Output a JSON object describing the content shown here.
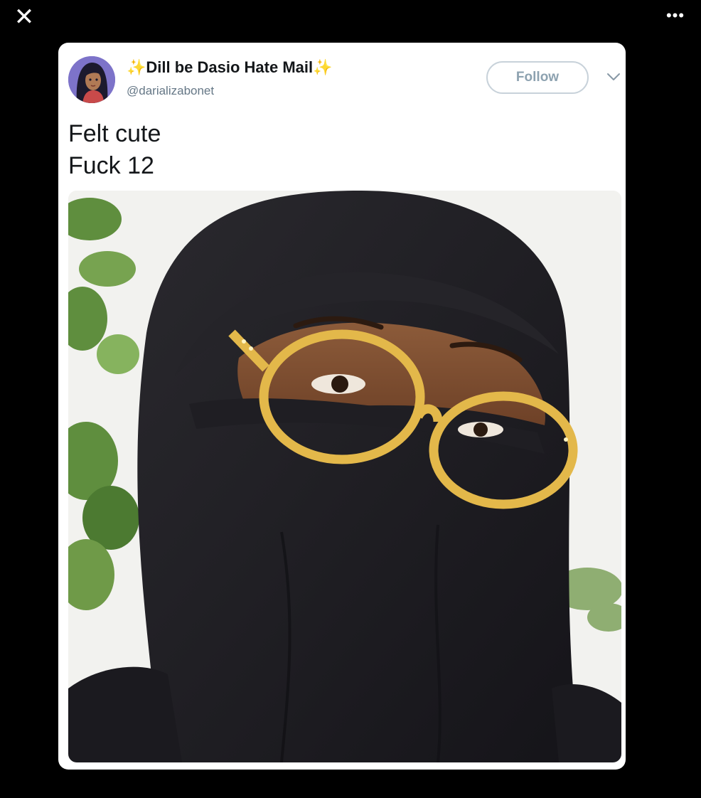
{
  "viewer": {
    "close_icon": "close-icon",
    "more_icon": "more-horizontal-icon",
    "close_glyph": "✕",
    "more_glyph": "•••"
  },
  "tweet": {
    "display_name": "✨Dill be Dasio Hate Mail✨",
    "handle": "@darializabonet",
    "follow_label": "Follow",
    "text_lines": [
      "Felt cute",
      "Fuck 12"
    ],
    "avatar_icon": "avatar",
    "chevron_icon": "chevron-down-icon"
  },
  "colors": {
    "background": "#000000",
    "card": "#ffffff",
    "name": "#14171a",
    "handle": "#657786",
    "follow_border": "#c8d2da",
    "follow_text": "#8da2b0",
    "glasses": "#e3b84a"
  }
}
